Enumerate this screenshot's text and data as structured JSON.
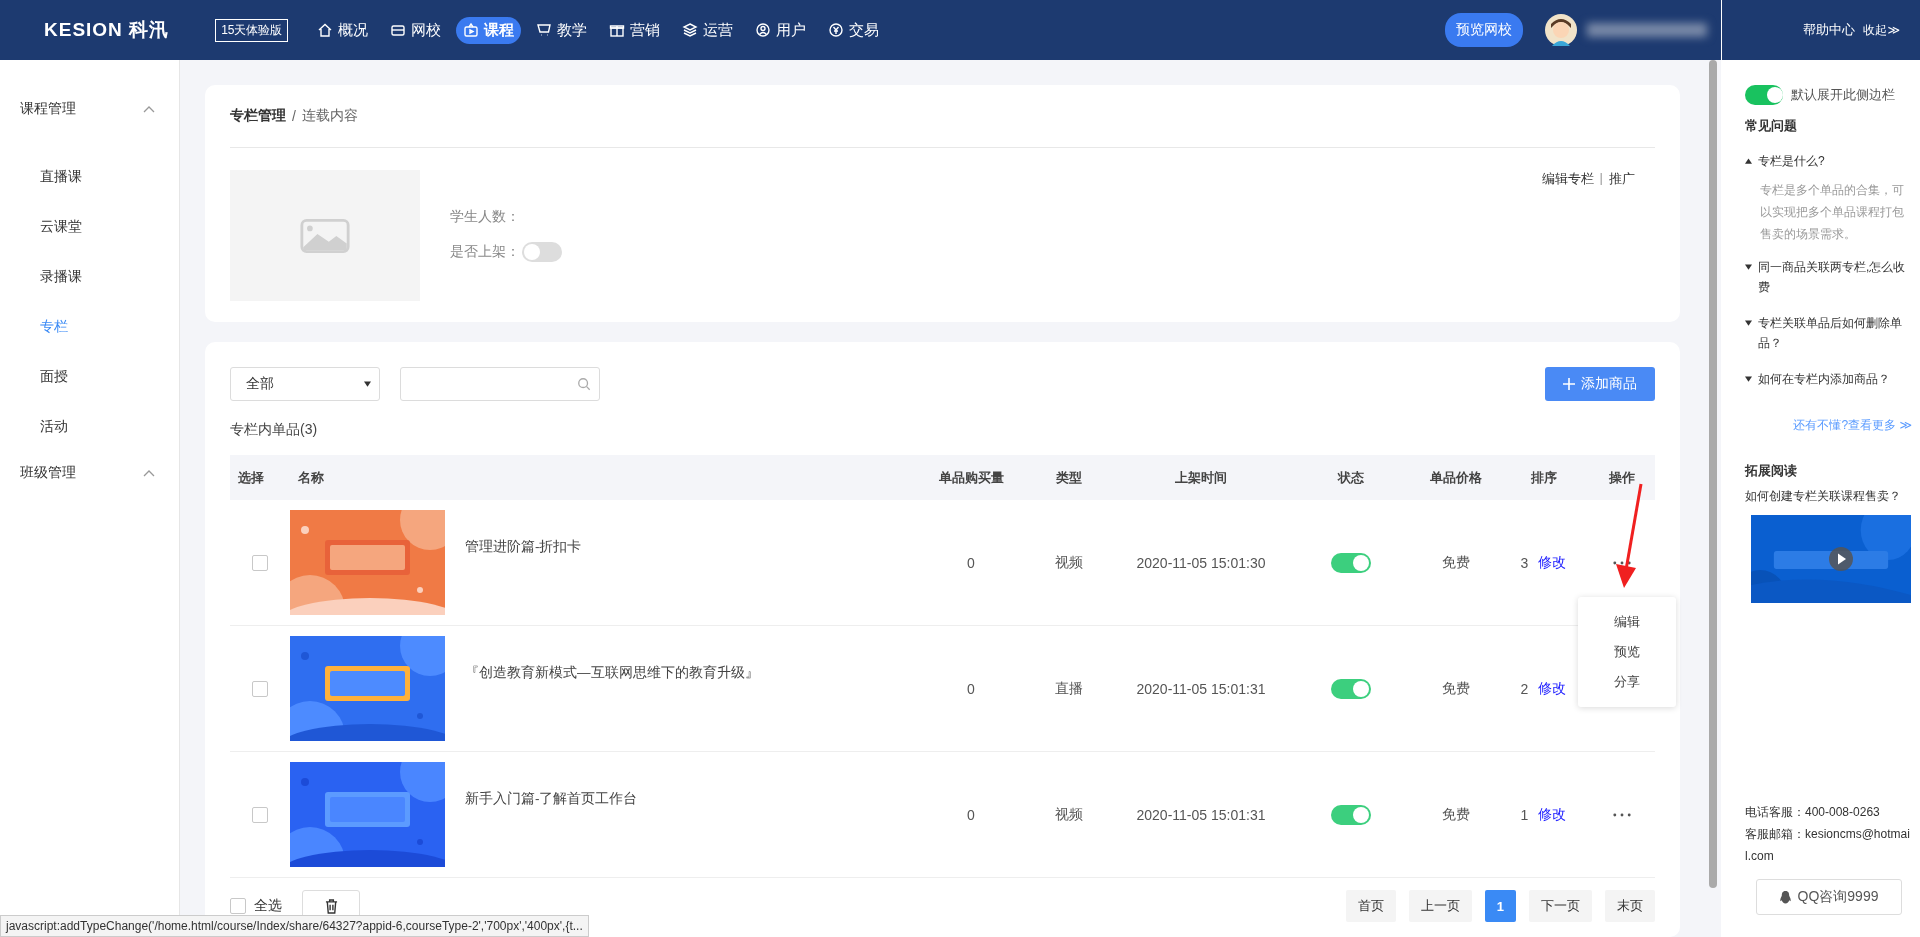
{
  "topbar": {
    "logo": "KESION 科汛",
    "trial_badge": "15天体验版",
    "nav": [
      {
        "label": "概况",
        "selected": false
      },
      {
        "label": "网校",
        "selected": false
      },
      {
        "label": "课程",
        "selected": true
      },
      {
        "label": "教学",
        "selected": false
      },
      {
        "label": "营销",
        "selected": false
      },
      {
        "label": "运营",
        "selected": false
      },
      {
        "label": "用户",
        "selected": false
      },
      {
        "label": "交易",
        "selected": false
      }
    ],
    "preview_button": "预览网校",
    "help_center": "帮助中心",
    "collapse": "收起≫"
  },
  "sidebar": {
    "groups": [
      {
        "label": "课程管理",
        "expanded": true,
        "children": [
          {
            "label": "直播课",
            "selected": false
          },
          {
            "label": "云课堂",
            "selected": false
          },
          {
            "label": "录播课",
            "selected": false
          },
          {
            "label": "专栏",
            "selected": true
          },
          {
            "label": "面授",
            "selected": false
          },
          {
            "label": "活动",
            "selected": false
          }
        ]
      },
      {
        "label": "班级管理",
        "expanded": true
      }
    ]
  },
  "breadcrumb": [
    "专栏管理",
    "连载内容"
  ],
  "breadcrumb_separator": "/",
  "links_separator": "|",
  "column_info": {
    "student_count_label": "学生人数：",
    "listed_label": "是否上架：",
    "listed": false,
    "links": [
      "编辑专栏",
      "推广"
    ]
  },
  "filter": {
    "select": "全部"
  },
  "add_button": "添加商品",
  "list_title": "专栏内单品(3)",
  "table": {
    "columns": [
      "选择",
      "名称",
      "单品购买量",
      "类型",
      "上架时间",
      "状态",
      "单品价格",
      "排序",
      "操作"
    ],
    "rows": [
      {
        "checked": false,
        "name": "管理进阶篇-折扣卡",
        "purchases": "0",
        "type": "视频",
        "time": "2020-11-05 15:01:30",
        "on": true,
        "price": "免费",
        "order": "3",
        "edit": "修改"
      },
      {
        "checked": false,
        "name": "『创造教育新模式—互联网思维下的教育升级』",
        "purchases": "0",
        "type": "直播",
        "time": "2020-11-05 15:01:31",
        "on": true,
        "price": "免费",
        "order": "2",
        "edit": "修改"
      },
      {
        "checked": false,
        "name": "新手入门篇-了解首页工作台",
        "purchases": "0",
        "type": "视频",
        "time": "2020-11-05 15:01:31",
        "on": true,
        "price": "免费",
        "order": "1",
        "edit": "修改"
      }
    ]
  },
  "row_menu": [
    "编辑",
    "预览",
    "分享"
  ],
  "footer": {
    "select_all": "全选",
    "select_all_checked": false,
    "pagination": [
      {
        "label": "首页",
        "selected": false
      },
      {
        "label": "上一页",
        "selected": false
      },
      {
        "label": "1",
        "selected": true
      },
      {
        "label": "下一页",
        "selected": false
      },
      {
        "label": "末页",
        "selected": false
      }
    ]
  },
  "status_url": "javascript:addTypeChange('/home.html/course/Index/share/64327?appid-6,courseType-2','700px','400px',{t...",
  "help": {
    "default_open_label": "默认展开此侧边栏",
    "default_open": true,
    "faq_title": "常见问题",
    "faq": [
      {
        "question": "专栏是什么?",
        "expanded": true,
        "answer": "专栏是多个单品的合集，可以实现把多个单品课程打包售卖的场景需求。"
      },
      {
        "question": "同一商品关联两专栏,怎么收费",
        "expanded": false
      },
      {
        "question": "专栏关联单品后如何删除单品？",
        "expanded": false
      },
      {
        "question": "如何在专栏内添加商品？",
        "expanded": false
      }
    ],
    "more_link": "还有不懂?查看更多 ≫",
    "reading_title": "拓展阅读",
    "reading_item": "如何创建专栏关联课程售卖？",
    "phone": "电话客服：400-008-0263",
    "email": "客服邮箱：kesioncms@hotmail.com",
    "qq_button": "QQ咨询9999"
  }
}
